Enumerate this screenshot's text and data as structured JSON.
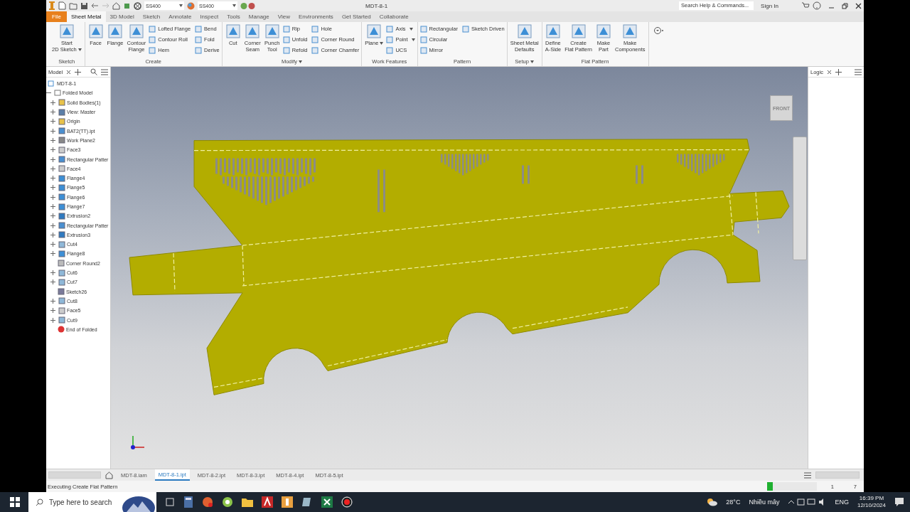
{
  "quick_access": {
    "material": "SS400",
    "appearance": "SS400"
  },
  "window": {
    "title": "MDT-8-1"
  },
  "search": {
    "placeholder": "Search Help & Commands..."
  },
  "sign_in": "Sign In",
  "tabs": [
    {
      "label": "File",
      "kind": "app_menu",
      "selected": false
    },
    {
      "label": "Sheet Metal",
      "kind": "tab",
      "selected": true
    },
    {
      "label": "3D Model",
      "kind": "tab",
      "selected": false
    },
    {
      "label": "Sketch",
      "kind": "tab",
      "selected": false
    },
    {
      "label": "Annotate",
      "kind": "tab",
      "selected": false
    },
    {
      "label": "Inspect",
      "kind": "tab",
      "selected": false
    },
    {
      "label": "Tools",
      "kind": "tab",
      "selected": false
    },
    {
      "label": "Manage",
      "kind": "tab",
      "selected": false
    },
    {
      "label": "View",
      "kind": "tab",
      "selected": false
    },
    {
      "label": "Environments",
      "kind": "tab",
      "selected": false
    },
    {
      "label": "Get Started",
      "kind": "tab",
      "selected": false
    },
    {
      "label": "Collaborate",
      "kind": "tab",
      "selected": false
    }
  ],
  "ribbon": [
    {
      "title": "Sketch",
      "has_menu": false,
      "large": [
        {
          "lines": [
            "Start",
            "2D Sketch"
          ],
          "dropdown": true
        }
      ]
    },
    {
      "title": "Create",
      "has_menu": false,
      "large": [
        {
          "lines": [
            "Face"
          ],
          "dropdown": false
        },
        {
          "lines": [
            "Flange"
          ],
          "dropdown": false
        },
        {
          "lines": [
            "Contour",
            "Flange"
          ],
          "dropdown": false
        }
      ],
      "small": [
        {
          "label": "Lofted Flange",
          "dropdown": false
        },
        {
          "label": "Contour Roll",
          "dropdown": false
        },
        {
          "label": "Hem",
          "dropdown": false
        },
        {
          "label": "Bend",
          "dropdown": false
        },
        {
          "label": "Fold",
          "dropdown": false
        },
        {
          "label": "Derive",
          "dropdown": false
        }
      ]
    },
    {
      "title": "Modify",
      "has_menu": true,
      "large": [
        {
          "lines": [
            "Cut"
          ],
          "dropdown": false
        },
        {
          "lines": [
            "Corner",
            "Seam"
          ],
          "dropdown": false
        },
        {
          "lines": [
            "Punch",
            "Tool"
          ],
          "dropdown": false
        }
      ],
      "small": [
        {
          "label": "Rip",
          "dropdown": false
        },
        {
          "label": "Unfold",
          "dropdown": false
        },
        {
          "label": "Refold",
          "dropdown": false
        },
        {
          "label": "Hole",
          "dropdown": false
        },
        {
          "label": "Corner Round",
          "dropdown": false
        },
        {
          "label": "Corner Chamfer",
          "dropdown": false
        }
      ]
    },
    {
      "title": "Work Features",
      "has_menu": false,
      "large": [
        {
          "lines": [
            "Plane"
          ],
          "dropdown": true
        }
      ],
      "small": [
        {
          "label": "Axis",
          "dropdown": true
        },
        {
          "label": "Point",
          "dropdown": true
        },
        {
          "label": "UCS",
          "dropdown": false
        }
      ]
    },
    {
      "title": "Pattern",
      "has_menu": false,
      "small": [
        {
          "label": "Rectangular",
          "dropdown": false
        },
        {
          "label": "Circular",
          "dropdown": false
        },
        {
          "label": "Mirror",
          "dropdown": false
        },
        {
          "label": "Sketch Driven",
          "dropdown": false
        }
      ]
    },
    {
      "title": "Setup",
      "has_menu": true,
      "large": [
        {
          "lines": [
            "Sheet Metal",
            "Defaults"
          ],
          "dropdown": false
        }
      ]
    },
    {
      "title": "Flat Pattern",
      "has_menu": false,
      "large": [
        {
          "lines": [
            "Define",
            "A-Side"
          ],
          "dropdown": false
        },
        {
          "lines": [
            "Create",
            "Flat Pattern"
          ],
          "dropdown": false
        },
        {
          "lines": [
            "Make",
            "Part"
          ],
          "dropdown": false
        },
        {
          "lines": [
            "Make",
            "Components"
          ],
          "dropdown": false
        }
      ]
    }
  ],
  "browser": {
    "tab": "Model",
    "tree": [
      {
        "label": "MDT-8-1",
        "kind": "part",
        "children": [
          {
            "label": "Folded Model",
            "kind": "model",
            "expanded": true,
            "children": [
              {
                "label": "Solid Bodies(1)",
                "kind": "folder",
                "expanded": false
              },
              {
                "label": "View: Master",
                "kind": "view",
                "expanded": false
              },
              {
                "label": "Origin",
                "kind": "folder",
                "expanded": false
              },
              {
                "label": "BAT2(TT).ipt",
                "kind": "part",
                "expanded": false
              },
              {
                "label": "Work Plane2",
                "kind": "plane",
                "expanded": false
              },
              {
                "label": "Face3",
                "kind": "face",
                "expanded": false
              },
              {
                "label": "Rectangular Patter",
                "kind": "pattern",
                "expanded": false
              },
              {
                "label": "Face4",
                "kind": "face",
                "expanded": false
              },
              {
                "label": "Flange4",
                "kind": "flange",
                "expanded": false
              },
              {
                "label": "Flange5",
                "kind": "flange",
                "expanded": false
              },
              {
                "label": "Flange6",
                "kind": "flange",
                "expanded": false
              },
              {
                "label": "Flange7",
                "kind": "flange",
                "expanded": false
              },
              {
                "label": "Extrusion2",
                "kind": "extrusion",
                "expanded": false
              },
              {
                "label": "Rectangular Patter",
                "kind": "pattern",
                "expanded": false
              },
              {
                "label": "Extrusion3",
                "kind": "extrusion",
                "expanded": false
              },
              {
                "label": "Cut4",
                "kind": "cut",
                "expanded": false
              },
              {
                "label": "Flange8",
                "kind": "flange",
                "expanded": false
              },
              {
                "label": "Corner Round2",
                "kind": "round"
              },
              {
                "label": "Cut6",
                "kind": "cut",
                "expanded": false
              },
              {
                "label": "Cut7",
                "kind": "cut",
                "expanded": false
              },
              {
                "label": "Sketch26",
                "kind": "sketch"
              },
              {
                "label": "Cut8",
                "kind": "cut",
                "expanded": false
              },
              {
                "label": "Face5",
                "kind": "face",
                "expanded": false
              },
              {
                "label": "Cut9",
                "kind": "cut",
                "expanded": false
              },
              {
                "label": "End of Folded",
                "kind": "end"
              }
            ]
          }
        ]
      }
    ]
  },
  "viewcube": {
    "label": "FRONT"
  },
  "right_panel": {
    "tab": "Logic"
  },
  "documents": [
    {
      "label": "MDT-8.iam",
      "selected": false
    },
    {
      "label": "MDT-8-1.ipt",
      "selected": true
    },
    {
      "label": "MDT-8-2.ipt",
      "selected": false
    },
    {
      "label": "MDT-8-3.ipt",
      "selected": false
    },
    {
      "label": "MDT-8-4.ipt",
      "selected": false
    },
    {
      "label": "MDT-8-5.ipt",
      "selected": false
    }
  ],
  "status_bar": {
    "message": "Executing Create Flat Pattern",
    "progress": {
      "level": 0.12
    },
    "count_1": "1",
    "count_2": "7"
  },
  "taskbar": {
    "search_placeholder": "Type here to search",
    "weather": "28°C",
    "weather_text": "Nhiều mây",
    "language": "ENG",
    "time": "16:39 PM",
    "date": "12/10/2024"
  }
}
